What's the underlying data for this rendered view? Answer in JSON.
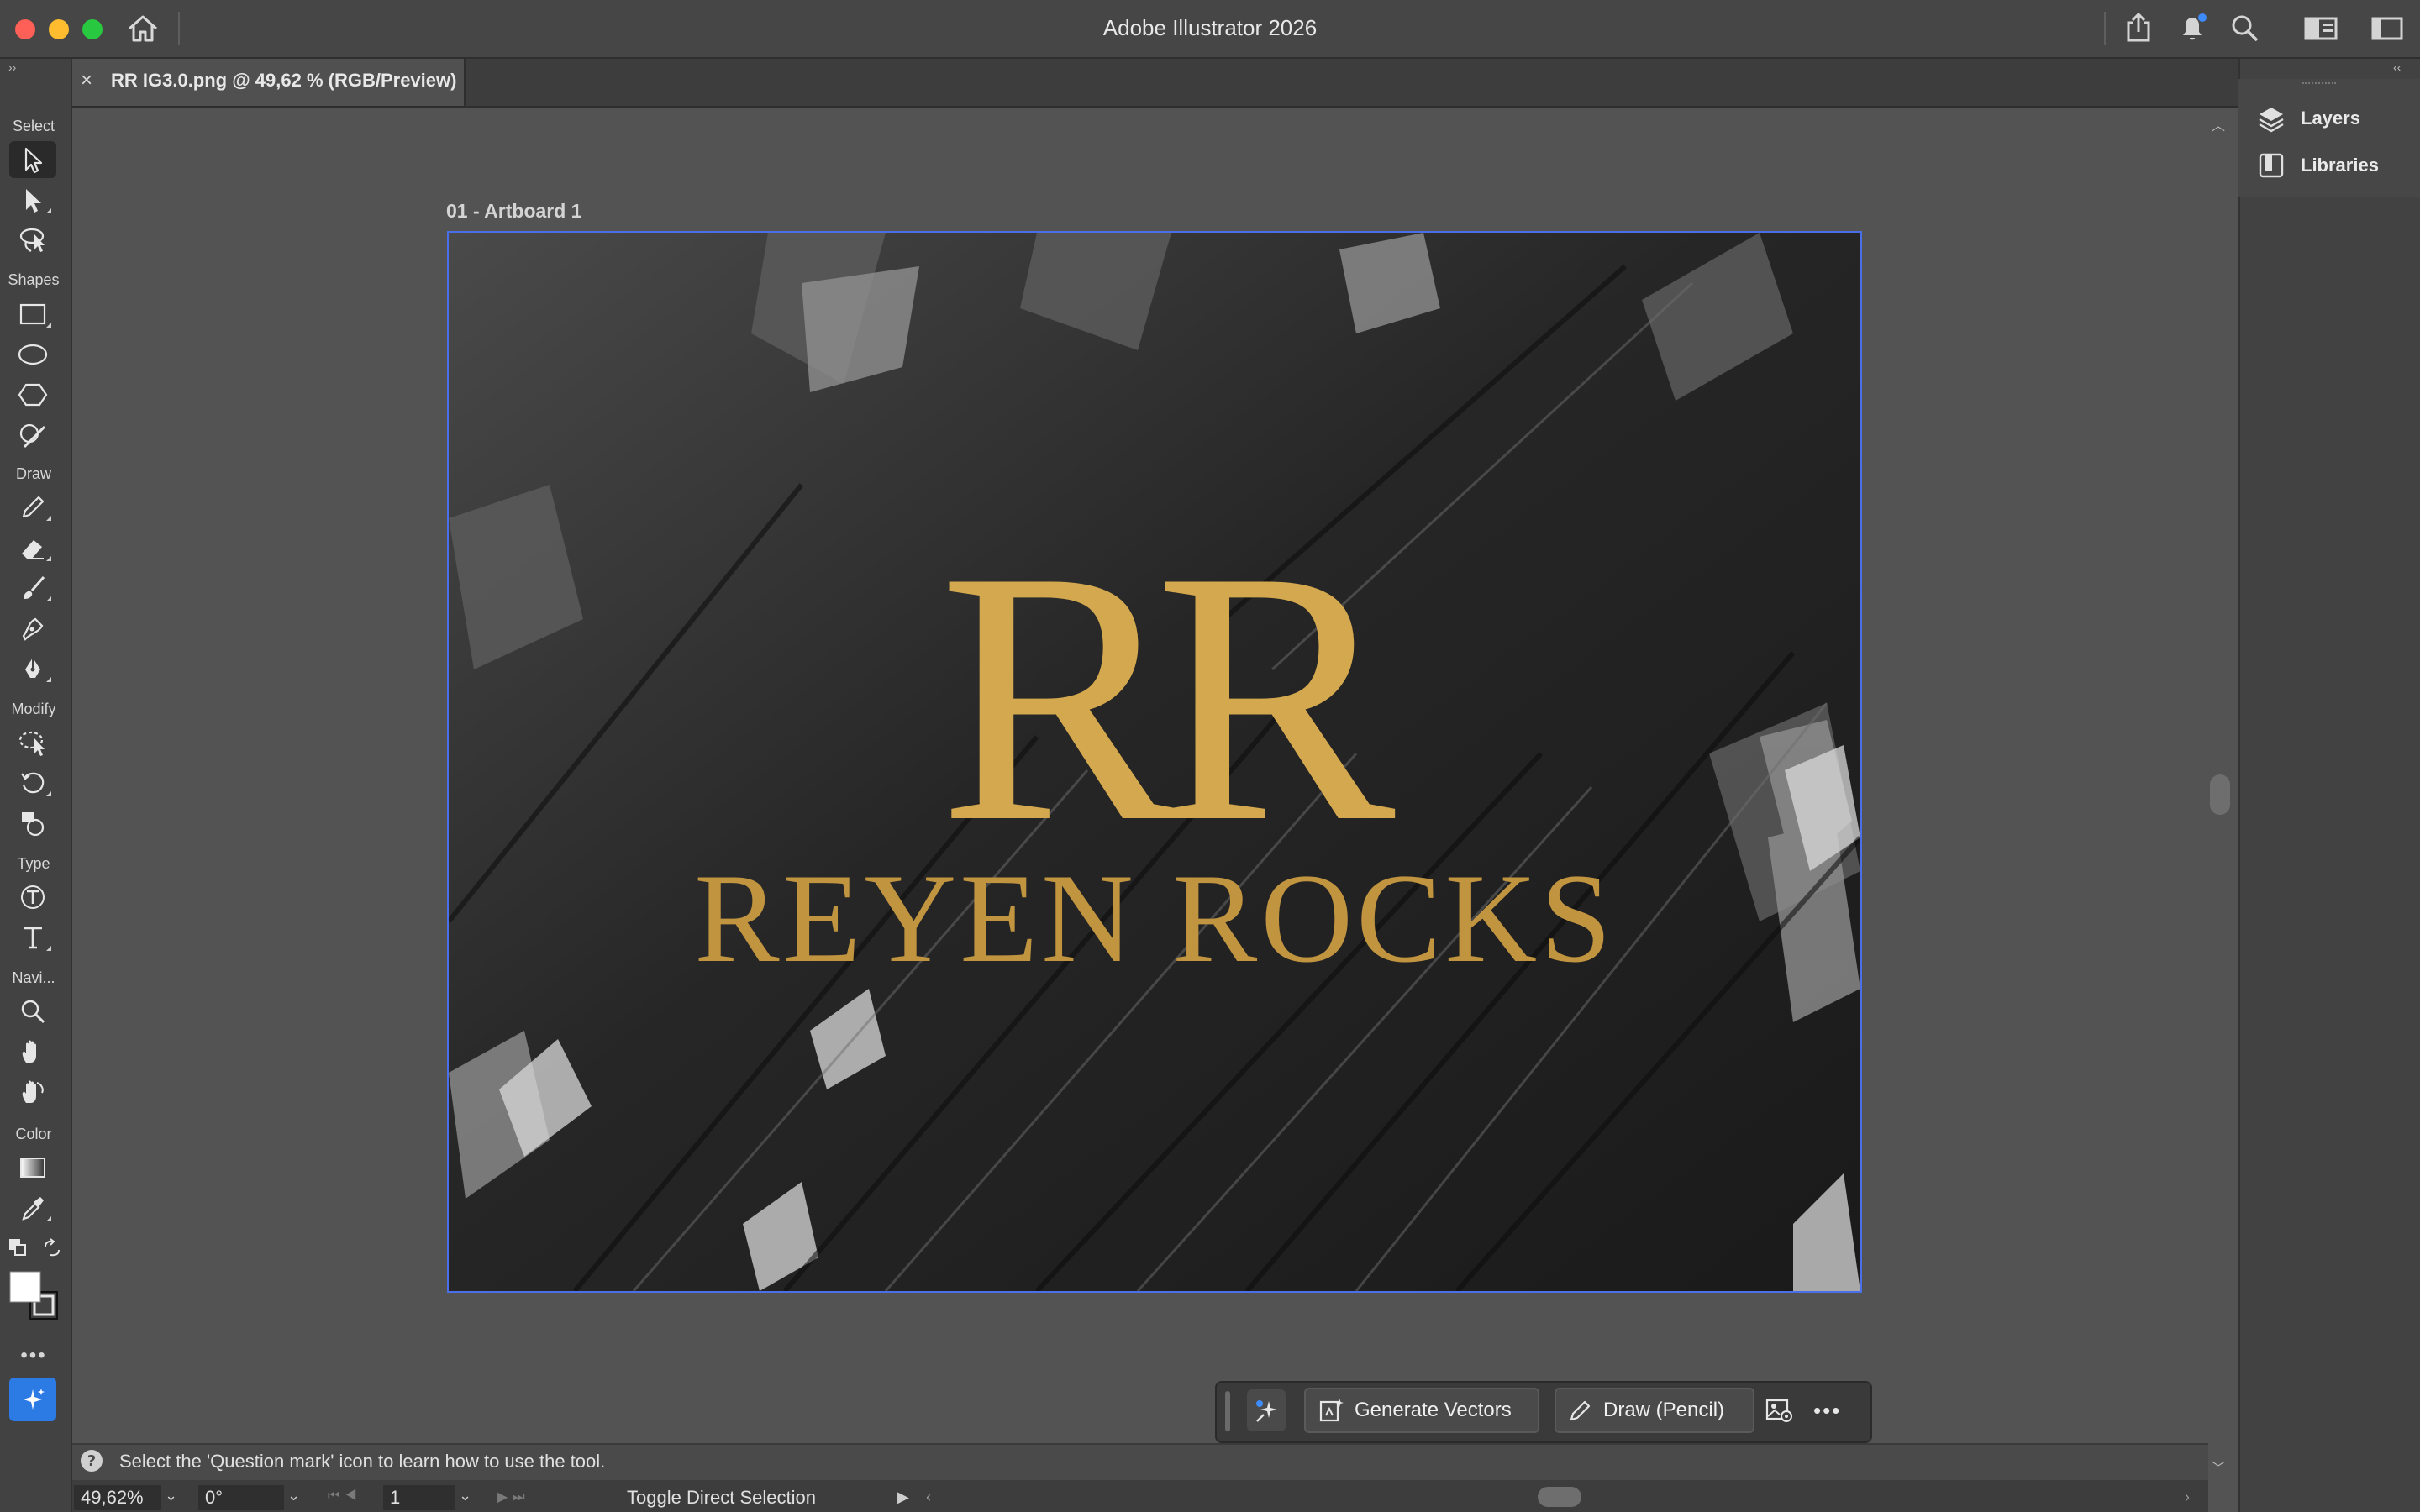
{
  "app": {
    "title": "Adobe Illustrator 2026"
  },
  "document": {
    "tab_title": "RR IG3.0.png @ 49,62 % (RGB/Preview)",
    "close_glyph": "×",
    "artboard_label": "01 - Artboard 1"
  },
  "artwork": {
    "monogram": "RR",
    "wordmark": "REYEN ROCKS",
    "gold_colors": [
      "#f0cf78",
      "#c99a3e",
      "#8a6524"
    ]
  },
  "toolbar": {
    "groups": {
      "select": "Select",
      "shapes": "Shapes",
      "draw": "Draw",
      "modify": "Modify",
      "type": "Type",
      "navigate": "Navi...",
      "color": "Color"
    },
    "more": "•••"
  },
  "panels": {
    "layers": "Layers",
    "libraries": "Libraries"
  },
  "taskbar": {
    "generate_vectors": "Generate Vectors",
    "draw_pencil": "Draw (Pencil)",
    "more": "•••"
  },
  "hint": {
    "text": "Select the 'Question mark' icon to learn how to use the tool."
  },
  "status": {
    "zoom": "49,62%",
    "rotation": "0°",
    "artboard_number": "1",
    "tool_label": "Toggle Direct Selection"
  },
  "colors": {
    "accent": "#4a6fe8",
    "ai_button": "#2c7be5",
    "notification_dot": "#3d8bfd"
  }
}
